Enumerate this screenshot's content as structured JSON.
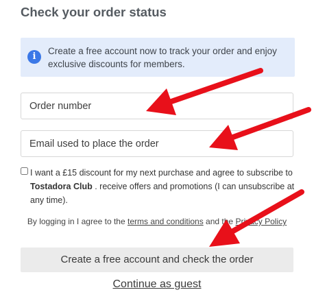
{
  "page": {
    "title": "Check your order status"
  },
  "info": {
    "icon": "info-icon",
    "icon_glyph": "i",
    "text": "Create a free account now to track your order and enjoy exclusive discounts for members."
  },
  "form": {
    "order_number_placeholder": "Order number",
    "email_placeholder": "Email used to place the order",
    "consent_before": "I want a £15 discount for my next purchase and agree to subscribe to ",
    "consent_brand": "Tostadora Club",
    "consent_after": " . receive offers and promotions (I can unsubscribe at any time).",
    "consent_checked": false,
    "legal_before": "By logging in I agree to the ",
    "terms_link": "terms and conditions",
    "legal_mid": " and the ",
    "privacy_link": "Privacy Policy",
    "submit_label": "Create a free account and check the order",
    "guest_label": "Continue as guest"
  },
  "annotations": {
    "arrow_color": "#e8101a"
  },
  "colors": {
    "info_bg": "#e3ecfb",
    "info_icon": "#3b78e7",
    "button_bg": "#ebebeb"
  }
}
